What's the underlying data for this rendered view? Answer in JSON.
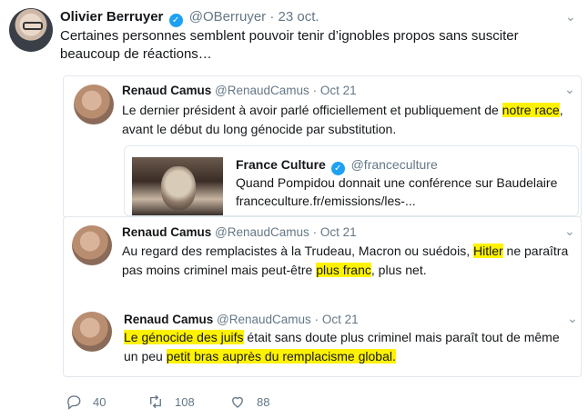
{
  "tweet": {
    "author_name": "Olivier Berruyer",
    "handle": "@OBerruyer",
    "date": "23 oct.",
    "separator": "·",
    "text_line1": "Certaines personnes semblent pouvoir tenir d’ignobles propos sans susciter",
    "text_line2": "beaucoup de réactions…"
  },
  "quote1": {
    "name": "Renaud Camus",
    "handle": "@RenaudCamus",
    "date": "Oct 21",
    "line1_a": "Le dernier président à avoir parlé officiellement et publiquement de ",
    "line1_hl": "notre race",
    "line1_b": ",",
    "line2": "avant le début du long génocide par substitution.",
    "card": {
      "name": "France Culture",
      "handle": "@franceculture",
      "line1": "Quand Pompidou donnait une conférence sur Baudelaire",
      "line2": "franceculture.fr/emissions/les-..."
    }
  },
  "quote2": {
    "name": "Renaud Camus",
    "handle": "@RenaudCamus",
    "date": "Oct 21",
    "line1_a": "Au regard des remplacistes à la Trudeau, Macron ou suédois, ",
    "line1_hl": "Hitler",
    "line1_b": " ne paraîtra",
    "line2_a": "pas moins criminel mais peut-être ",
    "line2_hl": "plus franc",
    "line2_b": ", plus net."
  },
  "quote3": {
    "name": "Renaud Camus",
    "handle": "@RenaudCamus",
    "date": "Oct 21",
    "line1_hl": "Le génocide des juifs",
    "line1_b": " était sans doute plus criminel mais paraît tout de même",
    "line2_a": "un peu ",
    "line2_hl": "petit bras auprès du remplacisme global."
  },
  "actions": {
    "replies": "40",
    "retweets": "108",
    "likes": "88"
  },
  "colors": {
    "accent": "#1da1f2",
    "highlight": "#fff200",
    "muted": "#657786",
    "border": "#e1e8ed"
  },
  "icons": [
    "verified-badge-icon",
    "chevron-down-icon",
    "reply-icon",
    "retweet-icon",
    "like-icon"
  ]
}
